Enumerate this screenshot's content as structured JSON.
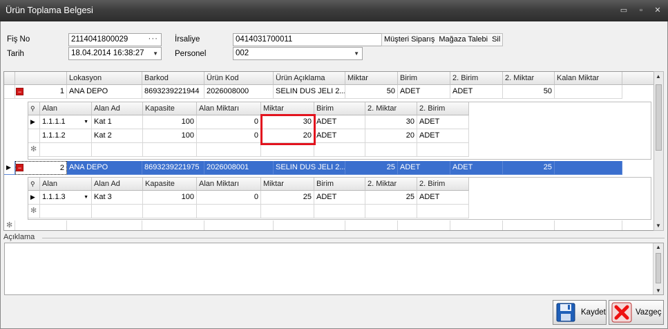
{
  "window": {
    "title": "Ürün Toplama Belgesi",
    "minimize": "▭",
    "restore": "▫",
    "close": "✕"
  },
  "form": {
    "fis_no_label": "Fiş No",
    "fis_no": "2114041800029",
    "tarih_label": "Tarih",
    "tarih": "18.04.2014 16:38:27",
    "irsaliye_label": "İrsaliye",
    "irsaliye": "0414031700011",
    "personel_label": "Personel",
    "personel": "002",
    "ellipsis": "···",
    "btn_musteri": "Müşteri Siparış",
    "btn_magaza": "Mağaza Talebi",
    "btn_sil": "Sil"
  },
  "grid": {
    "columns": [
      "Lokasyon",
      "Barkod",
      "Ürün Kod",
      "Ürün Açıklama",
      "Miktar",
      "Birim",
      "2. Birim",
      "2. Miktar",
      "Kalan Miktar"
    ],
    "rows": [
      {
        "no": "1",
        "lokasyon": "ANA DEPO",
        "barkod": "8693239221944",
        "urun_kod": "2026008000",
        "aciklama": "SELIN DUS JELI 2...",
        "miktar": "50",
        "birim": "ADET",
        "birim2": "ADET",
        "miktar2": "50",
        "kalan": ""
      },
      {
        "no": "2",
        "lokasyon": "ANA DEPO",
        "barkod": "8693239221975",
        "urun_kod": "2026008001",
        "aciklama": "SELIN DUS JELI 2...",
        "miktar": "25",
        "birim": "ADET",
        "birim2": "ADET",
        "miktar2": "25",
        "kalan": ""
      }
    ],
    "detail_columns": [
      "Alan",
      "Alan Ad",
      "Kapasite",
      "Alan Miktarı",
      "Miktar",
      "Birim",
      "2. Miktar",
      "2. Birim"
    ],
    "detail1": [
      {
        "alan": "1.1.1.1",
        "alan_ad": "Kat 1",
        "kapasite": "100",
        "alan_miktari": "0",
        "miktar": "30",
        "birim": "ADET",
        "miktar2": "30",
        "birim2": "ADET"
      },
      {
        "alan": "1.1.1.2",
        "alan_ad": "Kat 2",
        "kapasite": "100",
        "alan_miktari": "0",
        "miktar": "20",
        "birim": "ADET",
        "miktar2": "20",
        "birim2": "ADET"
      }
    ],
    "detail2": [
      {
        "alan": "1.1.1.3",
        "alan_ad": "Kat 3",
        "kapasite": "100",
        "alan_miktari": "0",
        "miktar": "25",
        "birim": "ADET",
        "miktar2": "25",
        "birim2": "ADET"
      }
    ],
    "new_row_marker": "✻",
    "collapse_glyph": "−"
  },
  "notes": {
    "label": "Açıklama",
    "value": ""
  },
  "buttons": {
    "kaydet": "Kaydet",
    "vazgec": "Vazgeç"
  },
  "colors": {
    "selection": "#3a6fce",
    "highlight_box": "#e2131e",
    "expand_button": "#d01616"
  }
}
